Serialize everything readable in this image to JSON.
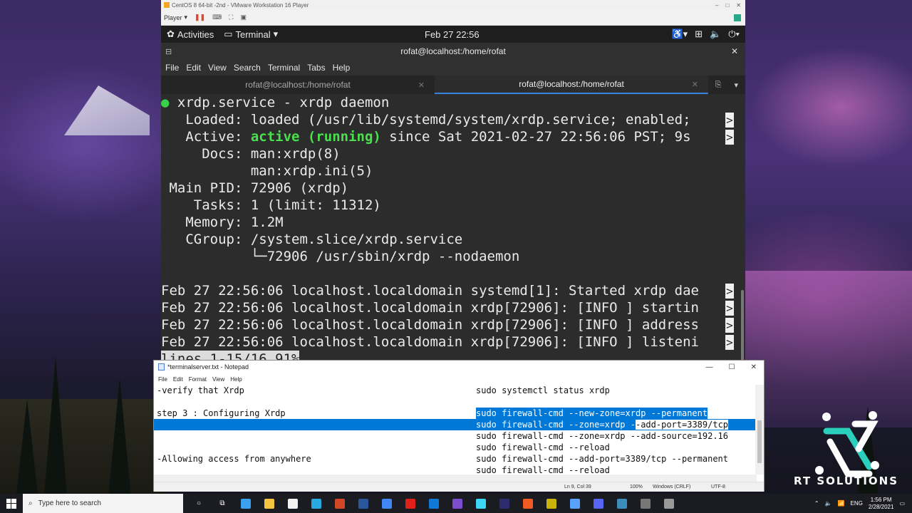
{
  "vmware": {
    "title": "CentOS 8 64-bit -2nd - VMware Workstation 16 Player",
    "player_label": "Player",
    "win_controls": [
      "–",
      "□",
      "✕"
    ]
  },
  "gnome": {
    "activities": "Activities",
    "terminal_menu": "Terminal",
    "clock": "Feb 27  22:56"
  },
  "terminal": {
    "window_title": "rofat@localhost:/home/rofat",
    "menu": [
      "File",
      "Edit",
      "View",
      "Search",
      "Terminal",
      "Tabs",
      "Help"
    ],
    "tabs": [
      {
        "label": "rofat@localhost:/home/rofat",
        "active": false
      },
      {
        "label": "rofat@localhost:/home/rofat",
        "active": true
      }
    ],
    "lines": {
      "l1": " xrdp.service - xrdp daemon",
      "l2_key": "   Loaded:",
      "l2_val": " loaded (/usr/lib/systemd/system/xrdp.service; enabled; ",
      "l3_key": "   Active:",
      "l3_green": " active (running)",
      "l3_val": " since Sat 2021-02-27 22:56:06 PST; 9s ",
      "l4": "     Docs: man:xrdp(8)",
      "l5": "           man:xrdp.ini(5)",
      "l6": " Main PID: 72906 (xrdp)",
      "l7": "    Tasks: 1 (limit: 11312)",
      "l8": "   Memory: 1.2M",
      "l9": "   CGroup: /system.slice/xrdp.service",
      "l10": "           └─72906 /usr/sbin/xrdp --nodaemon",
      "l12": "Feb 27 22:56:06 localhost.localdomain systemd[1]: Started xrdp dae",
      "l13": "Feb 27 22:56:06 localhost.localdomain xrdp[72906]: [INFO ] startin",
      "l14": "Feb 27 22:56:06 localhost.localdomain xrdp[72906]: [INFO ] address",
      "l15": "Feb 27 22:56:06 localhost.localdomain xrdp[72906]: [INFO ] listeni",
      "status": "lines 1-15/16 91%"
    },
    "continuation_mark": ">"
  },
  "notepad": {
    "title": "*terminalserver.txt - Notepad",
    "menu": [
      "File",
      "Edit",
      "Format",
      "View",
      "Help"
    ],
    "rows": [
      {
        "left": "-verify that Xrdp",
        "right": "sudo systemctl status xrdp"
      },
      {
        "left": "",
        "right": ""
      },
      {
        "left": "step 3 : Configuring Xrdp",
        "right": "sudo firewall-cmd --new-zone=xrdp --permanent"
      },
      {
        "left": "",
        "right_sel": "sudo firewall-cmd --zone=xrdp -",
        "right_rest": "-add-port=3389/tcp"
      },
      {
        "left": "",
        "right": "sudo firewall-cmd --zone=xrdp --add-source=192.16"
      },
      {
        "left": "",
        "right": "sudo firewall-cmd --reload"
      },
      {
        "left": "-Allowing access from anywhere",
        "right": "sudo firewall-cmd --add-port=3389/tcp --permanent"
      },
      {
        "left": "",
        "right": "sudo firewall-cmd --reload"
      }
    ],
    "status": {
      "position": "Ln 9, Col 39",
      "zoom": "100%",
      "line_ending": "Windows (CRLF)",
      "encoding": "UTF-8"
    }
  },
  "logo": {
    "text": "RT SOLUTIONS"
  },
  "taskbar": {
    "search_placeholder": "Type here to search",
    "tray_lang": "ENG",
    "time": "1:56 PM",
    "date": "2/28/2021",
    "app_colors": [
      "#3aa0f0",
      "#f5c542",
      "#f3f3f3",
      "#29a9e1",
      "#d24726",
      "#2b579a",
      "#4285f4",
      "#e0201b",
      "#0e7ad6",
      "#7c4dcc",
      "#3dd6f5",
      "#2c2c6e",
      "#f25a22",
      "#c9b30a",
      "#5aa2ff",
      "#5865f2",
      "#3c8dbc",
      "#777777",
      "#999999"
    ]
  }
}
